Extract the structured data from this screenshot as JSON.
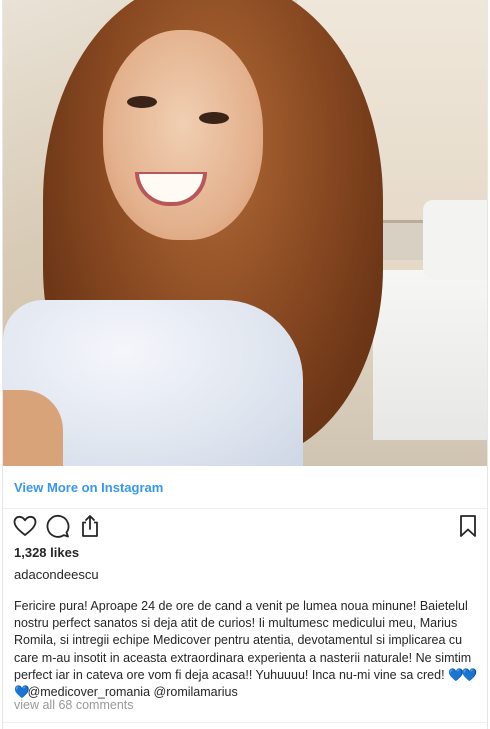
{
  "post": {
    "view_more_label": "View More on Instagram",
    "likes": "1,328 likes",
    "username": "adacondeescu",
    "caption": {
      "text": "Fericire pura! Aproape 24 de ore de cand a venit pe lumea noua minune! Baietelul nostru perfect sanatos si deja atit de curios! Ii multumesc medicului meu, Marius Romila, si intregii echipe Medicover pentru atentia, devotamentul si implicarea cu care m-au insotit in aceasta extraordinara experienta a nasterii naturale! Ne simtim perfect iar in cateva ore vom fi deja acasa!! Yuhuuuu! Inca nu-mi vine sa cred! ",
      "emoji": "💙💙💙",
      "mentions": "@medicover_romania @romilamarius"
    },
    "view_comments": "view all 68 comments"
  },
  "icons": {
    "like": "heart-icon",
    "comment": "comment-icon",
    "share": "share-icon",
    "save": "bookmark-icon"
  },
  "colors": {
    "link": "#3897f0",
    "text": "#262626",
    "muted": "#999999"
  }
}
